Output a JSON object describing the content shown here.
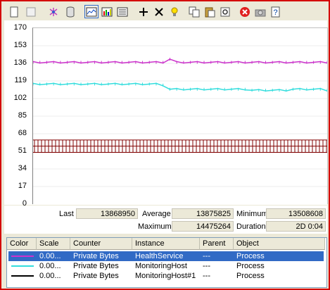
{
  "toolbar": {
    "buttons": [
      {
        "name": "new-counter-set-icon",
        "glyph": "□"
      },
      {
        "name": "clear-display-icon",
        "glyph": "▫"
      },
      {
        "name": "view-current-activity-icon",
        "glyph": "✱"
      },
      {
        "name": "view-log-data-icon",
        "glyph": "◙"
      },
      {
        "name": "view-graph-icon",
        "glyph": "▤"
      },
      {
        "name": "view-histogram-icon",
        "glyph": "▦"
      },
      {
        "name": "view-report-icon",
        "glyph": "▥"
      },
      {
        "name": "add-counter-icon",
        "glyph": "+"
      },
      {
        "name": "delete-counter-icon",
        "glyph": "×"
      },
      {
        "name": "highlight-icon",
        "glyph": "💡"
      },
      {
        "name": "copy-properties-icon",
        "glyph": "⧉"
      },
      {
        "name": "paste-counter-list-icon",
        "glyph": "📋"
      },
      {
        "name": "properties-icon",
        "glyph": "⚙"
      },
      {
        "name": "freeze-display-icon",
        "glyph": "✖"
      },
      {
        "name": "update-data-icon",
        "glyph": "📷"
      },
      {
        "name": "help-icon",
        "glyph": "?"
      }
    ]
  },
  "chart_data": {
    "type": "line",
    "ylim": [
      0,
      170
    ],
    "yticks": [
      "170",
      "153",
      "136",
      "119",
      "102",
      "85",
      "68",
      "51",
      "34",
      "17",
      "0"
    ],
    "series": [
      {
        "color": "#cc33cc",
        "values": [
          137,
          137,
          137,
          137,
          137,
          137,
          137,
          137,
          137,
          137,
          137,
          137,
          137,
          137,
          137,
          137,
          137,
          137,
          137,
          137,
          140,
          137,
          137,
          137,
          137,
          137,
          137,
          137,
          137,
          137,
          137,
          137,
          137,
          137,
          137,
          137,
          137,
          137,
          137,
          137,
          137,
          137,
          137,
          137
        ]
      },
      {
        "color": "#33dddd",
        "values": [
          116,
          116,
          116,
          116,
          116,
          116,
          116,
          116,
          116,
          116,
          116,
          116,
          116,
          116,
          116,
          116,
          116,
          116,
          116,
          115,
          111,
          111,
          111,
          111,
          111,
          111,
          111,
          111,
          111,
          111,
          111,
          111,
          110,
          110,
          110,
          110,
          110,
          110,
          111,
          111,
          111,
          111,
          111,
          110
        ]
      },
      {
        "color": "#800000",
        "band": [
          50,
          62
        ]
      }
    ]
  },
  "stats": {
    "last_label": "Last",
    "last_value": "13868950",
    "average_label": "Average",
    "average_value": "13875825",
    "minimum_label": "Minimum",
    "minimum_value": "13508608",
    "maximum_label": "Maximum",
    "maximum_value": "14475264",
    "duration_label": "Duration",
    "duration_value": "2D 0:04"
  },
  "legend": {
    "headers": {
      "color": "Color",
      "scale": "Scale",
      "counter": "Counter",
      "instance": "Instance",
      "parent": "Parent",
      "object": "Object"
    },
    "rows": [
      {
        "color": "#cc33cc",
        "scale": "0.00...",
        "counter": "Private Bytes",
        "instance": "HealthService",
        "parent": "---",
        "object": "Process",
        "selected": true
      },
      {
        "color": "#33dddd",
        "scale": "0.00...",
        "counter": "Private Bytes",
        "instance": "MonitoringHost",
        "parent": "---",
        "object": "Process",
        "selected": false
      },
      {
        "color": "#000000",
        "scale": "0.00...",
        "counter": "Private Bytes",
        "instance": "MonitoringHost#1",
        "parent": "---",
        "object": "Process",
        "selected": false
      }
    ]
  }
}
